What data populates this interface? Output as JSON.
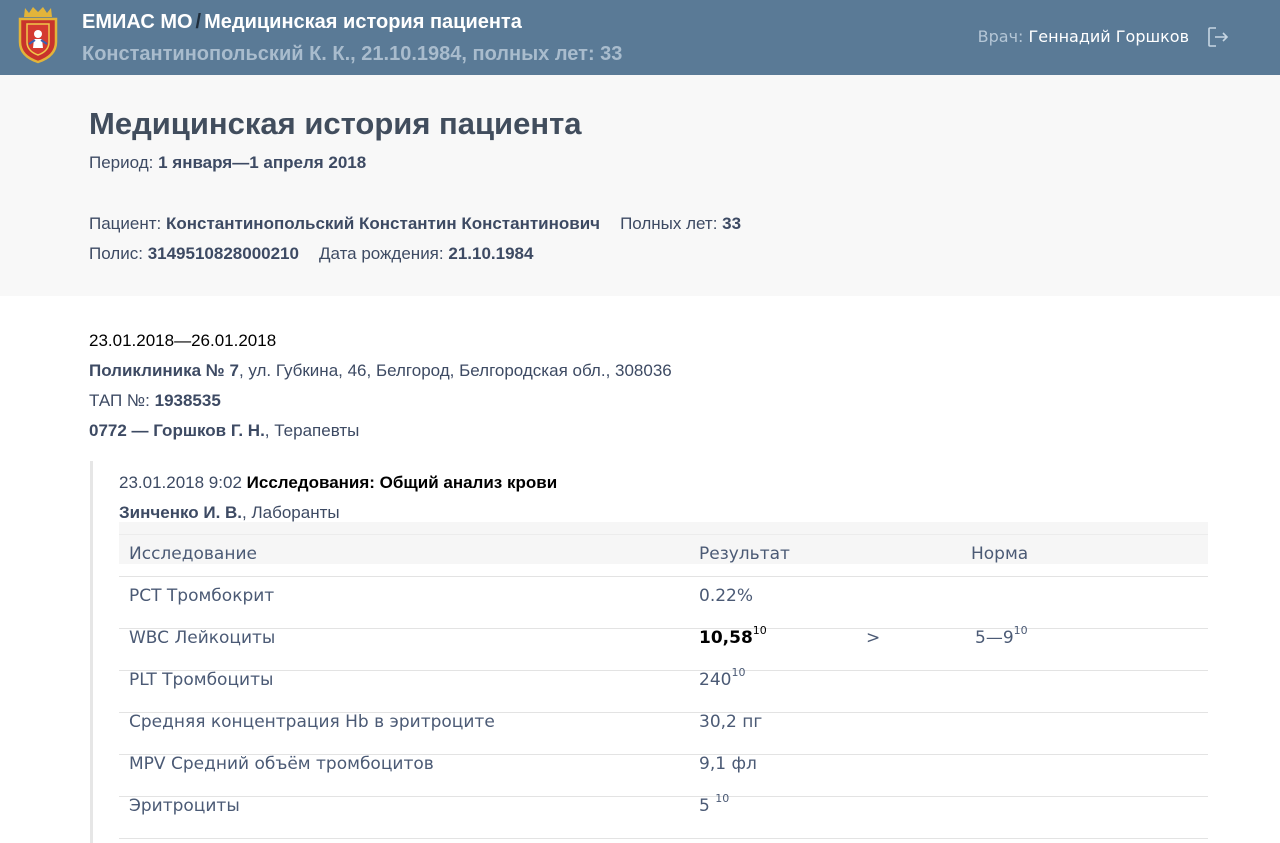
{
  "header": {
    "app_name": "ЕМИАС МО",
    "separator": "/",
    "section_title": "Медицинская история пациента",
    "patient_summary": "Константинопольский К. К., 21.10.1984, полных лет: 33",
    "doctor_label": "Врач:",
    "doctor_name": "Геннадий Горшков",
    "logo_icon": "moscow-region-coat-of-arms-icon",
    "logout_icon": "logout-icon"
  },
  "summary": {
    "title": "Медицинская история пациента",
    "period_label": "Период:",
    "period_value": "1 января—1 апреля 2018",
    "patient_label": "Пациент:",
    "patient_name": "Константинопольский Константин Константинович",
    "age_label": "Полных лет:",
    "age_value": "33",
    "policy_label": "Полис:",
    "policy_value": "3149510828000210",
    "dob_label": "Дата рождения:",
    "dob_value": "21.10.1984"
  },
  "visit": {
    "dates": "23.01.2018—26.01.2018",
    "clinic_name": "Поликлиника № 7",
    "clinic_address": ", ул. Губкина, 46, Белгород, Белгородская обл., 308036",
    "tap_label": "ТАП №:",
    "tap_value": "1938535",
    "doctor_code": "0772 — Горшков Г. Н.",
    "doctor_specialty": ", Терапевты"
  },
  "entry": {
    "datetime": "23.01.2018 9:02",
    "title": "Исследования: Общий анализ крови",
    "staff_name": "Зинченко И. В.",
    "staff_role": ", Лаборанты",
    "table": {
      "headers": [
        "Исследование",
        "Результат",
        "Норма"
      ],
      "rows": [
        {
          "name": "PCT Тромбокрит",
          "result": "0.22%",
          "result_sup": "",
          "flag": "",
          "norm": "",
          "norm_sup": ""
        },
        {
          "name": "WBC Лейкоциты",
          "result": "10,58",
          "result_sup": "10",
          "flag": ">",
          "norm": "5—9",
          "norm_sup": "10"
        },
        {
          "name": "PLT Тромбоциты",
          "result": "240",
          "result_sup": "10",
          "flag": "",
          "norm": "",
          "norm_sup": ""
        },
        {
          "name": "Средняя концентрация Hb в эритроците",
          "result": "30,2 пг",
          "result_sup": "",
          "flag": "",
          "norm": "",
          "norm_sup": ""
        },
        {
          "name": "MPV Средний объём тромбоцитов",
          "result": "9,1 фл",
          "result_sup": "",
          "flag": "",
          "norm": "",
          "norm_sup": ""
        },
        {
          "name": "Эритроциты",
          "result": "5 ",
          "result_sup": "10",
          "flag": "",
          "norm": "",
          "norm_sup": ""
        }
      ]
    }
  },
  "colors": {
    "topbar": "#5a7a96",
    "panel": "#f8f8f8",
    "text": "#3d4a63"
  }
}
